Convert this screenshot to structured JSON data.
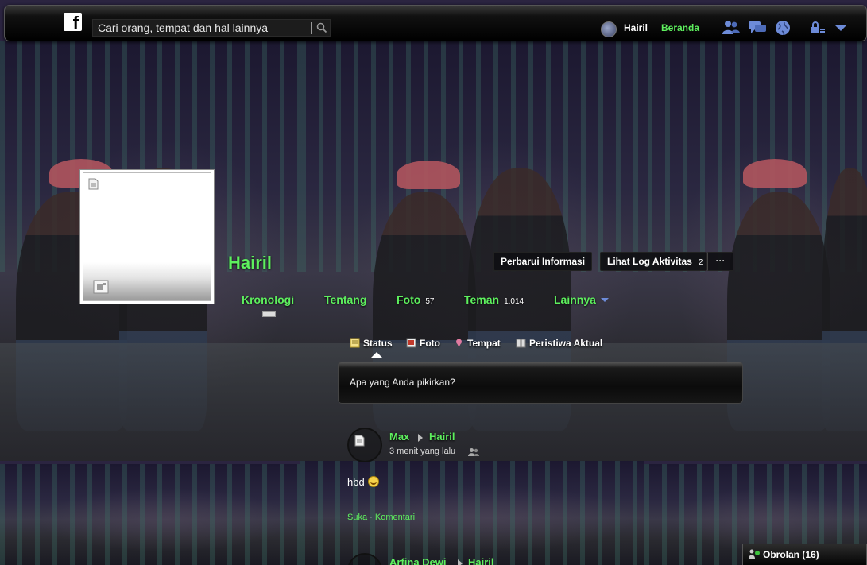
{
  "topbar": {
    "search": {
      "placeholder": "Cari orang, tempat dan hal lainnya"
    },
    "user_name": "Hairil",
    "home_link": "Beranda",
    "icons": [
      "facebook-logo-icon",
      "search-icon",
      "friend-requests-icon",
      "messages-icon",
      "notifications-globe-icon",
      "privacy-lock-icon",
      "account-menu-chevron-icon"
    ]
  },
  "profile": {
    "name": "Hairil",
    "actions": {
      "update_info": "Perbarui Informasi",
      "activity_log": "Lihat Log Aktivitas",
      "activity_log_count": "2",
      "more": "···"
    },
    "nav": [
      {
        "label": "Kronologi",
        "count": ""
      },
      {
        "label": "Tentang",
        "count": ""
      },
      {
        "label": "Foto",
        "count": "57"
      },
      {
        "label": "Teman",
        "count": "1.014"
      },
      {
        "label": "Lainnya",
        "count": ""
      }
    ]
  },
  "composer": {
    "tabs": [
      {
        "label": "Status",
        "icon": "status-note-icon"
      },
      {
        "label": "Foto",
        "icon": "photo-icon"
      },
      {
        "label": "Tempat",
        "icon": "place-pin-icon"
      },
      {
        "label": "Peristiwa Aktual",
        "icon": "life-event-icon"
      }
    ],
    "placeholder": "Apa yang Anda pikirkan?"
  },
  "posts": [
    {
      "author": "Max",
      "target": "Hairil",
      "time": "3 menit yang lalu",
      "text": "hbd",
      "actions": {
        "like": "Suka",
        "separator": "·",
        "comment": "Komentari"
      }
    },
    {
      "author": "Arfina Dewi",
      "target": "Hairil"
    }
  ],
  "chat": {
    "label": "Obrolan (16)"
  },
  "colors": {
    "accent_green": "#5ef05e",
    "topbar_bg": "#000000",
    "text_white": "#ffffff",
    "nav_caret_blue": "#6d8bd8"
  }
}
